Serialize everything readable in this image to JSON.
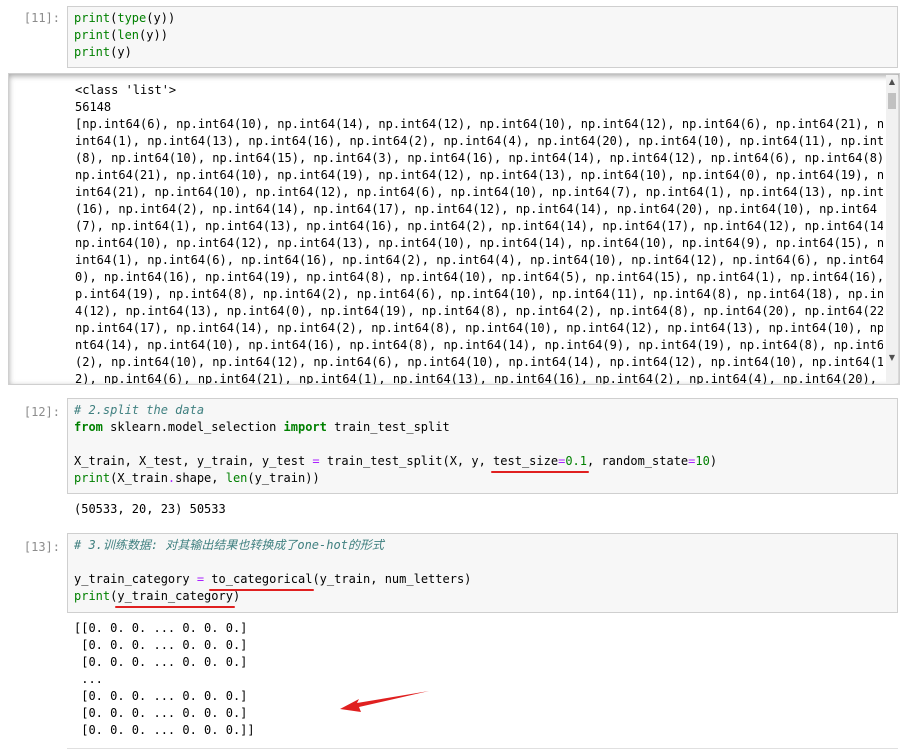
{
  "cells": {
    "c11": {
      "prompt": "[11]:"
    },
    "c12": {
      "prompt": "[12]:"
    },
    "c13": {
      "prompt": "[13]:"
    }
  },
  "code11": {
    "l1": {
      "fn": "print",
      "p1": "(",
      "fn2": "type",
      "p2": "(y))"
    },
    "l2": {
      "fn": "print",
      "p1": "(",
      "fn2": "len",
      "p2": "(y))"
    },
    "l3": {
      "fn": "print",
      "p1": "(y)"
    }
  },
  "out11": {
    "lines": [
      "<class 'list'>",
      "56148",
      "[np.int64(6), np.int64(10), np.int64(14), np.int64(12), np.int64(10), np.int64(12), np.int64(6), np.int64(21), np.",
      "int64(1), np.int64(13), np.int64(16), np.int64(2), np.int64(4), np.int64(20), np.int64(10), np.int64(11), np.int64",
      "(8), np.int64(10), np.int64(15), np.int64(3), np.int64(16), np.int64(14), np.int64(12), np.int64(6), np.int64(8),",
      "np.int64(21), np.int64(10), np.int64(19), np.int64(12), np.int64(13), np.int64(10), np.int64(0), np.int64(19), np.",
      "int64(21), np.int64(10), np.int64(12), np.int64(6), np.int64(10), np.int64(7), np.int64(1), np.int64(13), np.int64",
      "(16), np.int64(2), np.int64(14), np.int64(17), np.int64(12), np.int64(14), np.int64(20), np.int64(10), np.int64",
      "(7), np.int64(1), np.int64(13), np.int64(16), np.int64(2), np.int64(14), np.int64(17), np.int64(12), np.int64(14),",
      "np.int64(10), np.int64(12), np.int64(13), np.int64(10), np.int64(14), np.int64(10), np.int64(9), np.int64(15), np.",
      "int64(1), np.int64(6), np.int64(16), np.int64(2), np.int64(4), np.int64(10), np.int64(12), np.int64(6), np.int64(1",
      "0), np.int64(16), np.int64(19), np.int64(8), np.int64(10), np.int64(5), np.int64(15), np.int64(1), np.int64(16), n",
      "p.int64(19), np.int64(8), np.int64(2), np.int64(6), np.int64(10), np.int64(11), np.int64(8), np.int64(18), np.int6",
      "4(12), np.int64(13), np.int64(0), np.int64(19), np.int64(8), np.int64(2), np.int64(8), np.int64(20), np.int64(22),",
      "np.int64(17), np.int64(14), np.int64(2), np.int64(8), np.int64(10), np.int64(12), np.int64(13), np.int64(10), np.i",
      "nt64(14), np.int64(10), np.int64(16), np.int64(8), np.int64(14), np.int64(9), np.int64(19), np.int64(8), np.int64",
      "(2), np.int64(10), np.int64(12), np.int64(6), np.int64(10), np.int64(14), np.int64(12), np.int64(10), np.int64(1",
      "2), np.int64(6), np.int64(21), np.int64(1), np.int64(13), np.int64(16), np.int64(2), np.int64(4), np.int64(20), n"
    ]
  },
  "code12": {
    "comment": "# 2.split the data",
    "l2": {
      "kw1": "from",
      "mod": " sklearn.model_selection ",
      "kw2": "import",
      "name": " train_test_split"
    },
    "l4": {
      "a": "X_train, X_test, y_train, y_test ",
      "eq": "=",
      "b": " train_test_split(X, y, ",
      "u1": "test_size",
      "eq2": "=",
      "u2": "0.1",
      "c": ", random_state",
      "eq3": "=",
      "n": "10",
      "d": ")"
    },
    "l5": {
      "fn": "print",
      "a": "(X_train",
      "dot": ".",
      "b": "shape, ",
      "fn2": "len",
      "c": "(y_train))"
    }
  },
  "out12": {
    "text": "(50533, 20, 23) 50533"
  },
  "code13": {
    "comment": "# 3.训练数据: 对其输出结果也转换成了one-hot的形式",
    "l3": {
      "a": "y_train_category ",
      "eq": "=",
      "sp": " ",
      "u1": "to_categorical",
      "b": "(y_train, num_letters)"
    },
    "l4": {
      "fn": "print",
      "p": "(",
      "u1": "y_train_category",
      "p2": ")"
    }
  },
  "out13": {
    "lines": [
      "[[0. 0. 0. ... 0. 0. 0.]",
      " [0. 0. 0. ... 0. 0. 0.]",
      " [0. 0. 0. ... 0. 0. 0.]",
      " ...",
      " [0. 0. 0. ... 0. 0. 0.]",
      " [0. 0. 0. ... 0. 0. 0.]",
      " [0. 0. 0. ... 0. 0. 0.]]"
    ]
  },
  "colors": {
    "annotation": "#e02020",
    "keyword": "#008000",
    "operator": "#aa22ff",
    "comment": "#408080"
  }
}
